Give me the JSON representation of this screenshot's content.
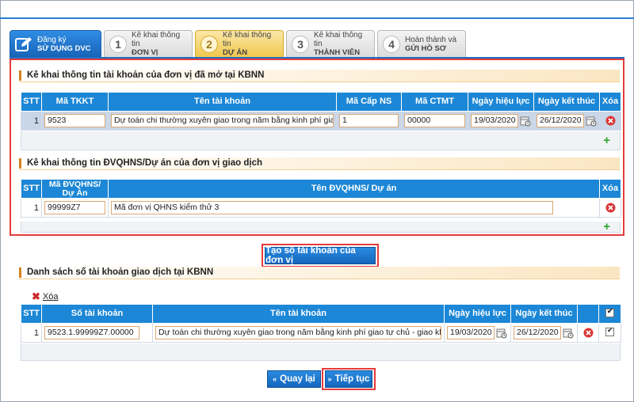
{
  "steps": [
    {
      "num": "",
      "line1": "Đăng ký",
      "line2": "SỬ DỤNG DVC",
      "state": "active"
    },
    {
      "num": "1",
      "line1": "Kê khai thông tin",
      "line2": "ĐƠN VỊ",
      "state": "normal"
    },
    {
      "num": "2",
      "line1": "Kê khai thông tin",
      "line2": "DỰ ÁN",
      "state": "current"
    },
    {
      "num": "3",
      "line1": "Kê khai thông tin",
      "line2": "THÀNH VIÊN",
      "state": "normal"
    },
    {
      "num": "4",
      "line1": "Hoàn thành và",
      "line2": "GỬI HỒ SƠ",
      "state": "normal"
    }
  ],
  "section1": {
    "title": "Kê khai thông tin tài khoản của đơn vị đã mở tại KBNN",
    "headers": [
      "STT",
      "Mã TKKT",
      "Tên tài khoản",
      "Mã Cấp NS",
      "Mã CTMT",
      "Ngày hiệu lực",
      "Ngày kết thúc",
      "Xóa"
    ],
    "rows": [
      {
        "stt": "1",
        "ma_tkkt": "9523",
        "ten_tk": "Dự toán chi thường xuyên giao trong năm bằng kinh phí giao",
        "ma_cap_ns": "1",
        "ma_ctmt": "00000",
        "ngay_hl": "19/03/2020",
        "ngay_kt": "26/12/2020"
      }
    ]
  },
  "section2": {
    "title": "Kê khai thông tin ĐVQHNS/Dự án của đơn vị giao dịch",
    "headers": [
      "STT",
      "Mã ĐVQHNS/ Dự Án",
      "Tên ĐVQHNS/ Dự án",
      "Xóa"
    ],
    "rows": [
      {
        "stt": "1",
        "ma": "99999Z7",
        "ten": "Mã đơn vị QHNS kiểm thử 3"
      }
    ]
  },
  "create_button": "Tạo số tài khoản của đơn vị",
  "section3": {
    "title": "Danh sách số tài khoản giao dịch tại KBNN",
    "delete_label": "Xóa",
    "headers": [
      "STT",
      "Số tài khoản",
      "Tên tài khoản",
      "Ngày hiệu lực",
      "Ngày kết thúc"
    ],
    "rows": [
      {
        "stt": "1",
        "so_tk": "9523.1.99999Z7.00000",
        "ten_tk": "Dự toán chi thường xuyên giao trong năm bằng kinh phí giao tự chủ - giao kho",
        "ngay_hl": "19/03/2020",
        "ngay_kt": "26/12/2020"
      }
    ]
  },
  "nav": {
    "back": "Quay lại",
    "next": "Tiếp tục"
  },
  "colors": {
    "accent_blue": "#1c87d6",
    "highlight_red": "#e53b3b",
    "current_step": "#f0c84e"
  }
}
